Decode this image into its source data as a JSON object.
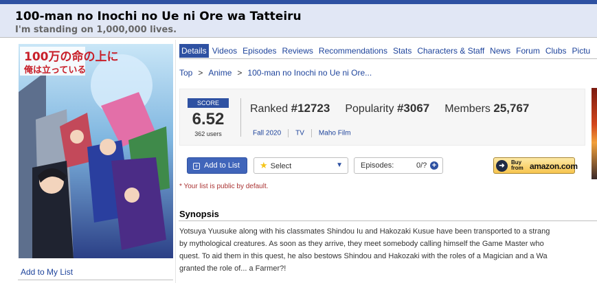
{
  "header": {
    "title": "100-man no Inochi no Ue ni Ore wa Tatteiru",
    "title_english": "I'm standing on 1,000,000 lives."
  },
  "sidebar": {
    "add_to_list": "Add to My List"
  },
  "tabs": [
    "Details",
    "Videos",
    "Episodes",
    "Reviews",
    "Recommendations",
    "Stats",
    "Characters & Staff",
    "News",
    "Forum",
    "Clubs",
    "Pictu"
  ],
  "breadcrumb": [
    "Top",
    "Anime",
    "100-man no Inochi no Ue ni Ore..."
  ],
  "stats": {
    "score_label": "SCORE",
    "score": "6.52",
    "score_users": "362 users",
    "ranked_label": "Ranked",
    "ranked_value": "#12723",
    "popularity_label": "Popularity",
    "popularity_value": "#3067",
    "members_label": "Members",
    "members_value": "25,767",
    "season": "Fall 2020",
    "type": "TV",
    "studio": "Maho Film"
  },
  "actions": {
    "add_to_list": "Add to List",
    "status_select": "Select",
    "episodes_label": "Episodes:",
    "episodes_count": "0/?",
    "buy_text": "Buy\nfrom",
    "amazon_brand": "amazon.com"
  },
  "notice": "* Your list is public by default.",
  "synopsis": {
    "heading": "Synopsis",
    "lines": [
      "Yotsuya Yuusuke along with his classmates Shindou Iu and Hakozaki Kusue have been transported to a strang",
      "by mythological creatures. As soon as they arrive, they meet somebody calling himself the Game Master who",
      "quest. To aid them in this quest, he also bestows Shindou and Hakozaki with the roles of a Magician and a Wa",
      "granted the role of... a Farmer?!"
    ]
  },
  "poster": {
    "logo_text_1": "100万の命の上に",
    "logo_text_2": "俺は立っている"
  },
  "colors": {
    "accent": "#2e51a2",
    "link": "#1d439b",
    "header_bg": "#e1e7f5"
  }
}
